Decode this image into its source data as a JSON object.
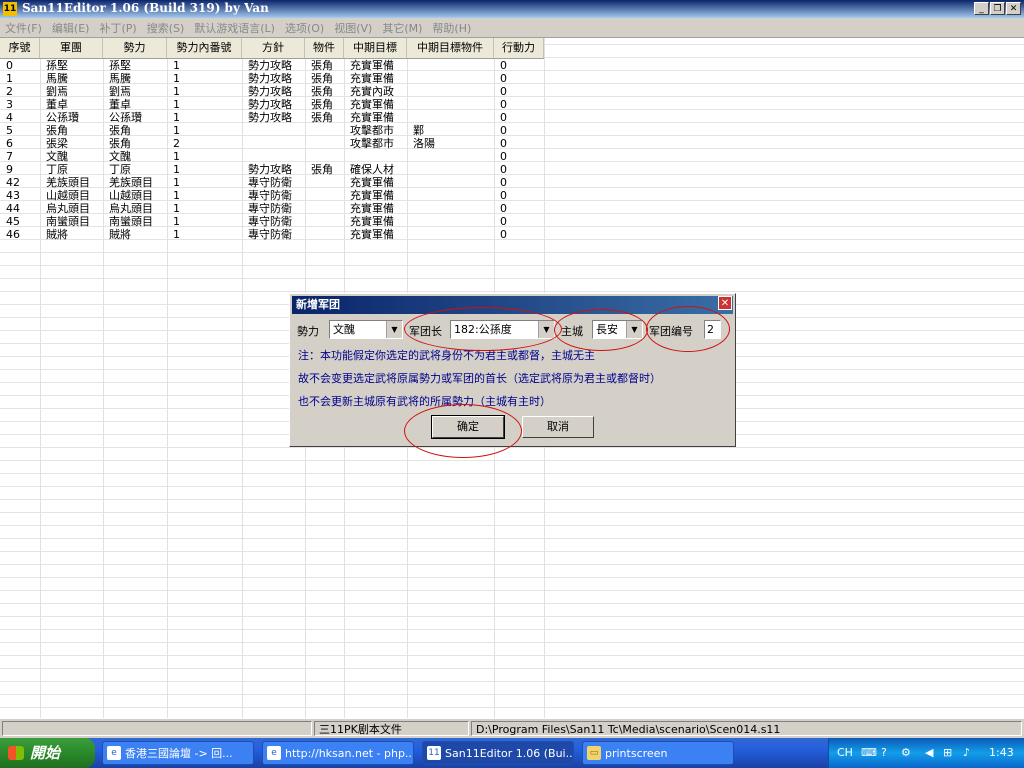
{
  "window": {
    "title": "San11Editor 1.06 (Build 319) by Van",
    "app_icon": "11"
  },
  "menu": [
    "文件(F)",
    "编辑(E)",
    "补丁(P)",
    "搜索(S)",
    "默认游戏语言(L)",
    "选项(O)",
    "视图(V)",
    "其它(M)",
    "帮助(H)"
  ],
  "table": {
    "columns": [
      "序號",
      "軍團",
      "勢力",
      "勢力內番號",
      "方針",
      "物件",
      "中期目標",
      "中期目標物件",
      "行動力"
    ],
    "rows": [
      [
        "0",
        "孫堅",
        "孫堅",
        "1",
        "勢力攻略",
        "張角",
        "充實軍備",
        "",
        "0"
      ],
      [
        "1",
        "馬騰",
        "馬騰",
        "1",
        "勢力攻略",
        "張角",
        "充實軍備",
        "",
        "0"
      ],
      [
        "2",
        "劉焉",
        "劉焉",
        "1",
        "勢力攻略",
        "張角",
        "充實內政",
        "",
        "0"
      ],
      [
        "3",
        "董卓",
        "董卓",
        "1",
        "勢力攻略",
        "張角",
        "充實軍備",
        "",
        "0"
      ],
      [
        "4",
        "公孫瓚",
        "公孫瓚",
        "1",
        "勢力攻略",
        "張角",
        "充實軍備",
        "",
        "0"
      ],
      [
        "5",
        "張角",
        "張角",
        "1",
        "",
        "",
        "攻擊都市",
        "鄴",
        "0"
      ],
      [
        "6",
        "張梁",
        "張角",
        "2",
        "",
        "",
        "攻擊都市",
        "洛陽",
        "0"
      ],
      [
        "7",
        "文醜",
        "文醜",
        "1",
        "",
        "",
        "",
        "",
        "0"
      ],
      [
        "9",
        "丁原",
        "丁原",
        "1",
        "勢力攻略",
        "張角",
        "確保人材",
        "",
        "0"
      ],
      [
        "42",
        "羌族頭目",
        "羌族頭目",
        "1",
        "專守防衛",
        "",
        "充實軍備",
        "",
        "0"
      ],
      [
        "43",
        "山越頭目",
        "山越頭目",
        "1",
        "專守防衛",
        "",
        "充實軍備",
        "",
        "0"
      ],
      [
        "44",
        "烏丸頭目",
        "烏丸頭目",
        "1",
        "專守防衛",
        "",
        "充實軍備",
        "",
        "0"
      ],
      [
        "45",
        "南蠻頭目",
        "南蠻頭目",
        "1",
        "專守防衛",
        "",
        "充實軍備",
        "",
        "0"
      ],
      [
        "46",
        "賊將",
        "賊將",
        "1",
        "專守防衛",
        "",
        "充實軍備",
        "",
        "0"
      ]
    ]
  },
  "dialog": {
    "title": "新增军团",
    "force_label": "勢力",
    "force_value": "文醜",
    "leader_label": "军团长",
    "leader_value": "182:公孫度",
    "city_label": "主城",
    "city_value": "長安",
    "id_label": "军团编号",
    "id_value": "2",
    "note1": "注：本功能假定你选定的武将身份不为君主或都督，主城无主",
    "note2": "故不会变更选定武将原属勢力或军团的首长（选定武将原为君主或都督时）",
    "note3": "也不会更新主城原有武将的所属勢力（主城有主时）",
    "ok_label": "确定",
    "cancel_label": "取消"
  },
  "status": {
    "panel1": "",
    "panel2": "三11PK剧本文件",
    "panel3": "D:\\Program Files\\San11 Tc\\Media\\scenario\\Scen014.s11"
  },
  "taskbar": {
    "start": "開始",
    "tasks": [
      "香港三國論壇 -> 回...",
      "http://hksan.net - php...",
      "San11Editor 1.06 (Bui...",
      "printscreen"
    ],
    "lang": "CH",
    "clock": "1:43"
  },
  "colors": {
    "title_bar": "#0a246a",
    "note_text": "#00008b",
    "annotation": "#d01010"
  }
}
